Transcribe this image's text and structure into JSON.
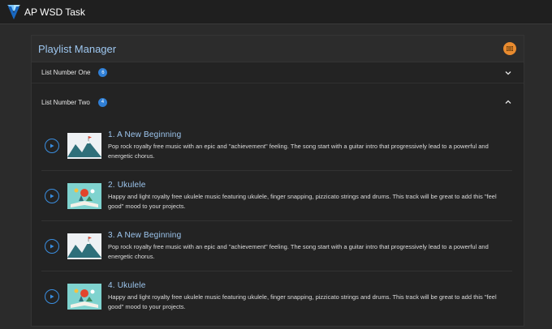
{
  "app": {
    "title": "AP WSD Task"
  },
  "panel": {
    "title": "Playlist Manager"
  },
  "lists": [
    {
      "name": "List Number One",
      "count": "6",
      "expanded": false
    },
    {
      "name": "List Number Two",
      "count": "4",
      "expanded": true
    }
  ],
  "tracks": [
    {
      "title": "1. A New Beginning",
      "desc": "Pop rock royalty free music with an epic and \"achievement\" feeling. The song start with a guitar intro that progressively lead to a powerful and energetic chorus.",
      "thumb": "mountain"
    },
    {
      "title": "2. Ukulele",
      "desc": "Happy and light royalty free ukulele music featuring ukulele, finger snapping, pizzicato strings and drums. This track will be great to add this \"feel good\" mood to your projects.",
      "thumb": "book"
    },
    {
      "title": "3. A New Beginning",
      "desc": "Pop rock royalty free music with an epic and \"achievement\" feeling. The song start with a guitar intro that progressively lead to a powerful and energetic chorus.",
      "thumb": "mountain"
    },
    {
      "title": "4. Ukulele",
      "desc": "Happy and light royalty free ukulele music featuring ukulele, finger snapping, pizzicato strings and drums. This track will be great to add this \"feel good\" mood to your projects.",
      "thumb": "book"
    }
  ],
  "colors": {
    "accent": "#2f7fd6",
    "title": "#9ec7f0",
    "action": "#e98b2f"
  }
}
